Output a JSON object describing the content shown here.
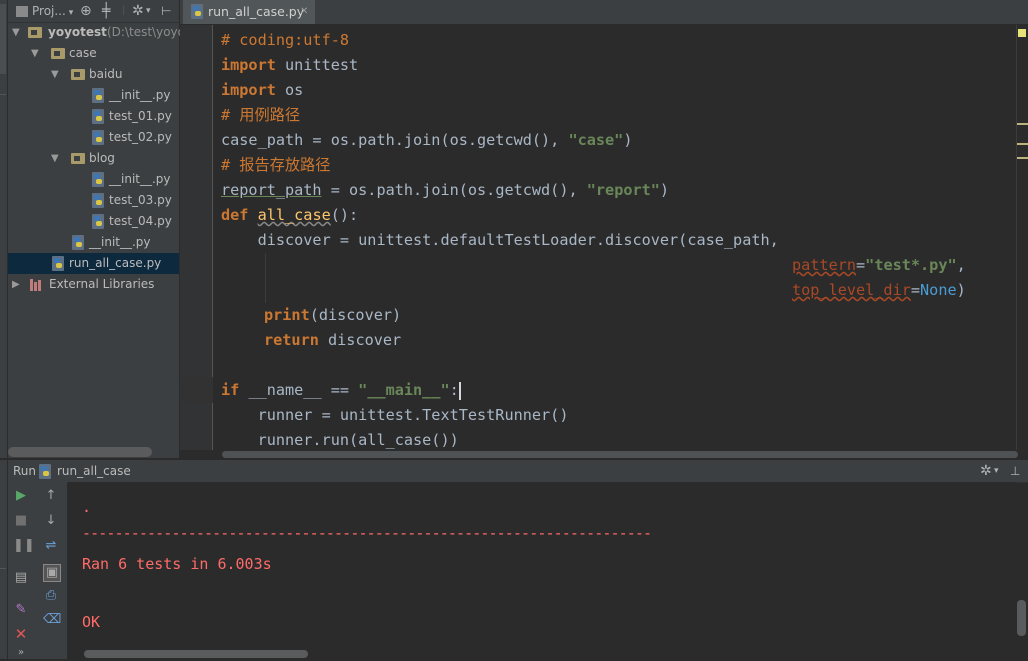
{
  "project_panel": {
    "title": "Proj...",
    "tree": {
      "root_name": "yoyotest",
      "root_path": "(D:\\test\\yoyo",
      "case": "case",
      "baidu": "baidu",
      "baidu_init": "__init__.py",
      "test_01": "test_01.py",
      "test_02": "test_02.py",
      "blog": "blog",
      "blog_init": "__init__.py",
      "test_03": "test_03.py",
      "test_04": "test_04.py",
      "case_init": "__init__.py",
      "run_all_case": "run_all_case.py",
      "external_libraries": "External Libraries"
    }
  },
  "editor": {
    "tab_label": "run_all_case.py",
    "code": {
      "l1": "# coding:utf-8",
      "l2_kw": "import",
      "l2_mod": " unittest",
      "l3_kw": "import",
      "l3_mod": " os",
      "l4": "# 用例路径",
      "l5_a": "case_path = os.path.join(os.getcwd(), ",
      "l5_str": "\"case\"",
      "l5_b": ")",
      "l6": "# 报告存放路径",
      "l7_var": "report_path",
      "l7_a": " = os.path.join(os.getcwd(), ",
      "l7_str": "\"report\"",
      "l7_b": ")",
      "l8_kw": "def",
      "l8_fn": "all_case",
      "l8_b": "():",
      "l9": "    discover = unittest.defaultTestLoader.discover(case_path,",
      "l10_param": "pattern",
      "l10_eq": "=",
      "l10_str": "\"test*.py\"",
      "l10_b": ",",
      "l11_param": "top_level_dir",
      "l11_eq": "=",
      "l11_none": "None",
      "l11_b": ")",
      "l12_kw": "print",
      "l12_b": "(discover)",
      "l13_kw": "return",
      "l13_b": " discover",
      "l14_kw": "if",
      "l14_a": " __name__ == ",
      "l14_str": "\"__main__\"",
      "l14_b": ":",
      "l15": "    runner = unittest.TextTestRunner()",
      "l16": "    runner.run(all_case())"
    }
  },
  "run_panel": {
    "label": "Run",
    "config": "run_all_case",
    "output": {
      "dot": ".",
      "dashes": "----------------------------------------------------------------------",
      "ran": "Ran 6 tests in 6.003s",
      "ok": "OK"
    }
  },
  "colors": {
    "keyword": "#cc7832",
    "string": "#6a8759",
    "error_output": "#ff6b68",
    "background": "#2b2b2b",
    "panel": "#3c3f41"
  }
}
